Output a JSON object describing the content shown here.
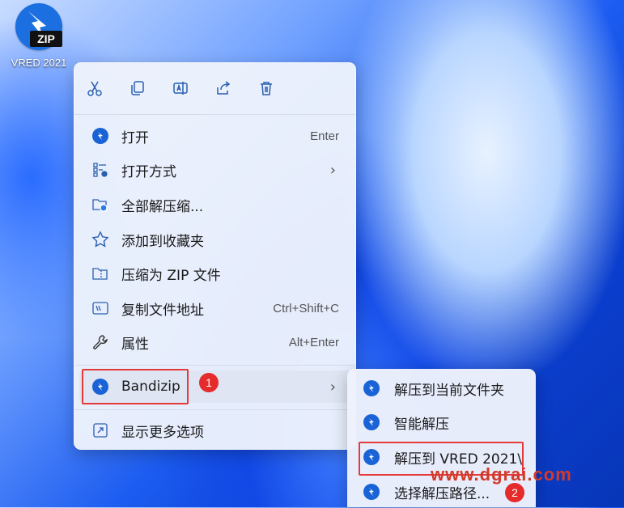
{
  "desktop": {
    "icon_label": "VRED 2021",
    "icon_badge_text": "ZIP",
    "icon_name": "bandizip-archive-icon"
  },
  "toolbar": [
    {
      "name": "cut-icon"
    },
    {
      "name": "copy-icon"
    },
    {
      "name": "rename-icon"
    },
    {
      "name": "share-icon"
    },
    {
      "name": "delete-icon"
    }
  ],
  "menu": {
    "items": [
      {
        "label": "打开",
        "shortcut": "Enter",
        "icon": "bandizip-icon"
      },
      {
        "label": "打开方式",
        "shortcut": "",
        "icon": "open-with-icon",
        "submenu": true
      },
      {
        "label": "全部解压缩...",
        "shortcut": "",
        "icon": "extract-all-icon"
      },
      {
        "label": "添加到收藏夹",
        "shortcut": "",
        "icon": "star-icon"
      },
      {
        "label": "压缩为 ZIP 文件",
        "shortcut": "",
        "icon": "zip-folder-icon"
      },
      {
        "label": "复制文件地址",
        "shortcut": "Ctrl+Shift+C",
        "icon": "copy-path-icon"
      },
      {
        "label": "属性",
        "shortcut": "Alt+Enter",
        "icon": "wrench-icon"
      }
    ],
    "bandizip": {
      "label": "Bandizip",
      "badge": "1"
    },
    "more": {
      "label": "显示更多选项",
      "icon": "more-options-icon"
    }
  },
  "submenu": {
    "items": [
      {
        "label": "解压到当前文件夹"
      },
      {
        "label": "智能解压"
      },
      {
        "label": "解压到 VRED 2021\\"
      },
      {
        "label": "选择解压路径..."
      }
    ],
    "badge": "2"
  },
  "watermark": "www.dgrai.com",
  "colors": {
    "accent": "#1a63d6",
    "highlight_border": "#e43a3a",
    "badge": "#e52b2b"
  }
}
